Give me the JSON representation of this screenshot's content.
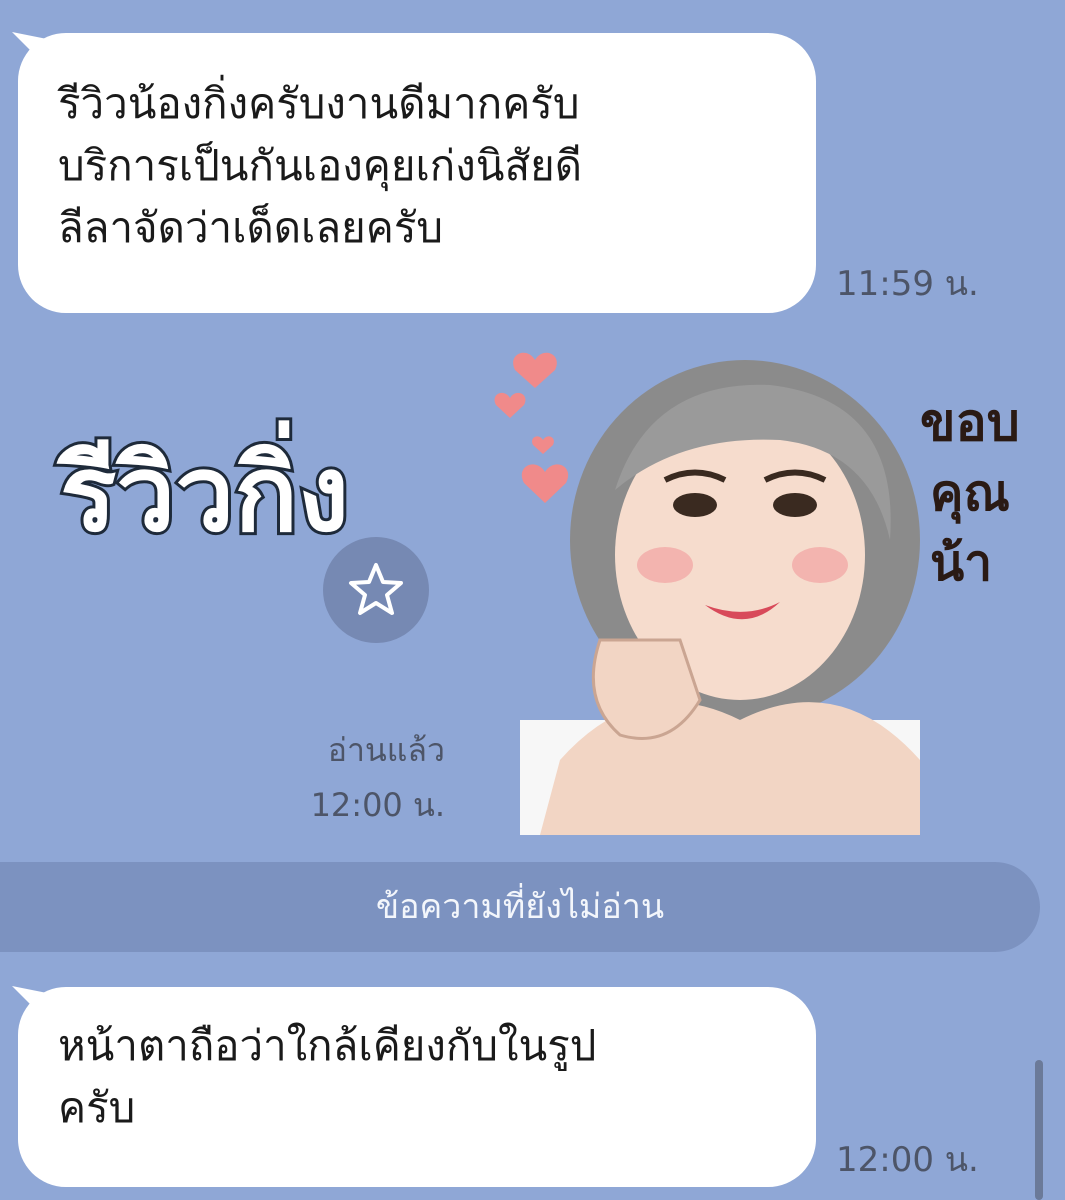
{
  "messages": [
    {
      "lines": [
        "รีวิวน้องกิ่งครับงานดีมากครับ",
        "บริการเป็นกันเองคุยเก่งนิสัยดี",
        "ลีลาจัดว่าเด็ดเลยครับ"
      ],
      "time": "11:59 น."
    },
    {
      "lines": [
        "หน้าตาถือว่าใกล้เคียงกับในรูป",
        "ครับ"
      ],
      "time": "12:00 น."
    }
  ],
  "sticker": {
    "title": "รีวิวกิ่ง",
    "side_lines": [
      "ขอบ",
      "คุณ",
      "น้า"
    ],
    "read_status": "อ่านแล้ว",
    "time": "12:00 น.",
    "favorite_icon": "star-outline-icon"
  },
  "unread_divider": "ข้อความที่ยังไม่อ่าน",
  "colors": {
    "background": "#8fa7d6",
    "bubble": "#ffffff",
    "divider": "#7c92c0",
    "heart": "#f08a8a"
  }
}
